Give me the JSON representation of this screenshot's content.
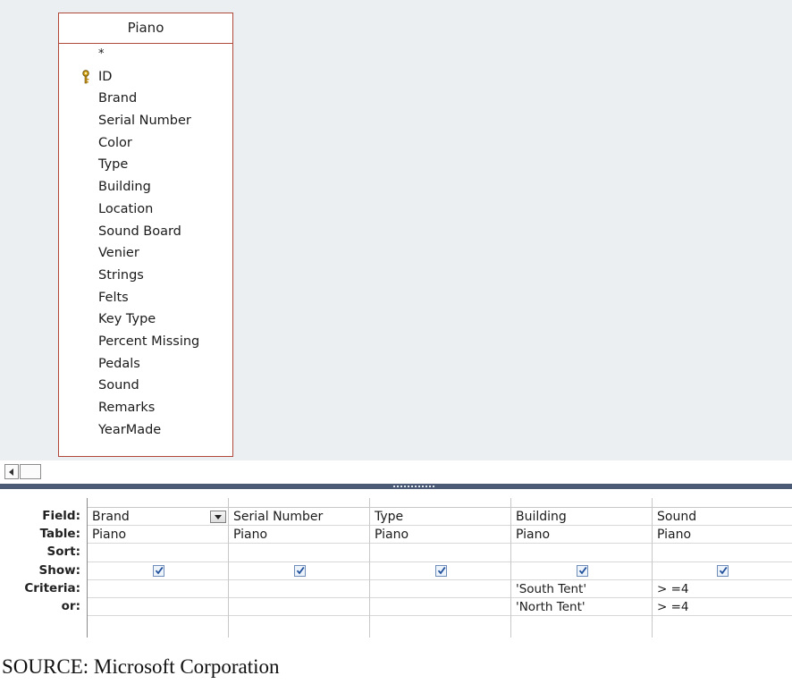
{
  "table": {
    "title": "Piano",
    "fields": [
      "*",
      "ID",
      "Brand",
      "Serial Number",
      "Color",
      "Type",
      "Building",
      "Location",
      "Sound Board",
      "Venier",
      "Strings",
      "Felts",
      "Key Type",
      "Percent Missing",
      "Pedals",
      "Sound",
      "Remarks",
      "YearMade"
    ],
    "primary_key": "ID"
  },
  "grid": {
    "row_labels": [
      "Field:",
      "Table:",
      "Sort:",
      "Show:",
      "Criteria:",
      "or:"
    ],
    "columns": [
      {
        "field": "Brand",
        "table": "Piano",
        "sort": "",
        "show": true,
        "criteria": "",
        "or": ""
      },
      {
        "field": "Serial Number",
        "table": "Piano",
        "sort": "",
        "show": true,
        "criteria": "",
        "or": ""
      },
      {
        "field": "Type",
        "table": "Piano",
        "sort": "",
        "show": true,
        "criteria": "",
        "or": ""
      },
      {
        "field": "Building",
        "table": "Piano",
        "sort": "",
        "show": true,
        "criteria": "'South Tent'",
        "or": "'North Tent'"
      },
      {
        "field": "Sound",
        "table": "Piano",
        "sort": "",
        "show": true,
        "criteria": "> =4",
        "or": "> =4"
      }
    ]
  },
  "caption": "SOURCE: Microsoft Corporation",
  "colors": {
    "table_border": "#b0483a",
    "splitter": "#4a5a75",
    "design_background": "#eceff1",
    "check": "#1f4f9b"
  },
  "icons": {
    "key": "key-icon",
    "dropdown": "chevron-down-icon",
    "scroll_left": "arrow-left-icon",
    "checkbox": "checkbox-checked-icon"
  }
}
